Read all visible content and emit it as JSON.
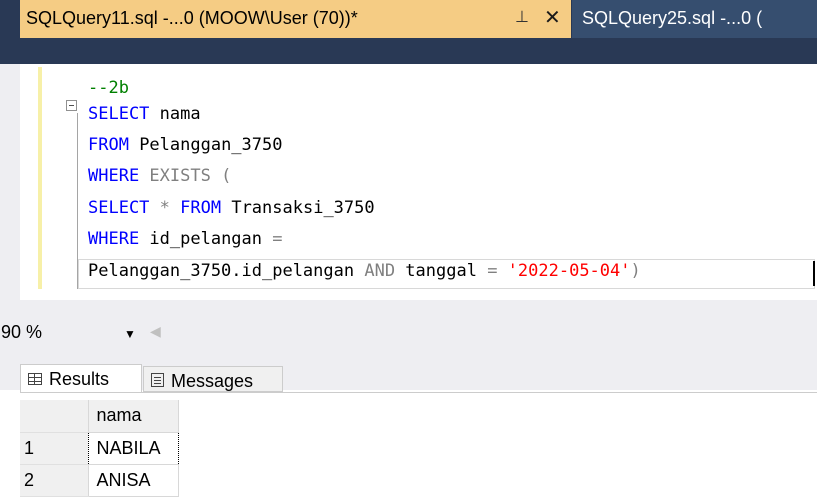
{
  "tabs": {
    "active_title": "SQLQuery11.sql -...0 (MOOW\\User (70))*",
    "pin_glyph": "⊥",
    "close_glyph": "✕",
    "inactive_title": "SQLQuery25.sql -...0 ("
  },
  "editor": {
    "line1_comment": "--2b",
    "line2_kw": "SELECT",
    "line2_rest": " nama",
    "line3_kw": "FROM",
    "line3_rest": " Pelanggan_3750",
    "line4_kw": "WHERE",
    "line4_exists": " EXISTS (",
    "line5_select": "SELECT",
    "line5_star": " * ",
    "line5_from": "FROM",
    "line5_rest": " Transaksi_3750",
    "line6_kw": "WHERE",
    "line6_rest": " id_pelangan ",
    "line6_eq": "=",
    "line7_a": "Pelanggan_3750.id_pelangan ",
    "line7_and": "AND",
    "line7_b": " tanggal ",
    "line7_eq": "=",
    "line7_str": " '2022-05-04'",
    "line7_paren": ")"
  },
  "zoom": {
    "value": "90 %",
    "arrow": "▼",
    "scroll_glyph": "◀"
  },
  "results_tabs": {
    "results_label": "Results",
    "messages_label": "Messages"
  },
  "grid": {
    "column": "nama",
    "rows": [
      {
        "n": "1",
        "nama": "NABILA"
      },
      {
        "n": "2",
        "nama": "ANISA"
      }
    ]
  },
  "colors": {
    "keyword": "#0000ff",
    "comment": "#008000",
    "string": "#ff0000",
    "active_tab": "#f5cc84",
    "chrome": "#293955"
  }
}
